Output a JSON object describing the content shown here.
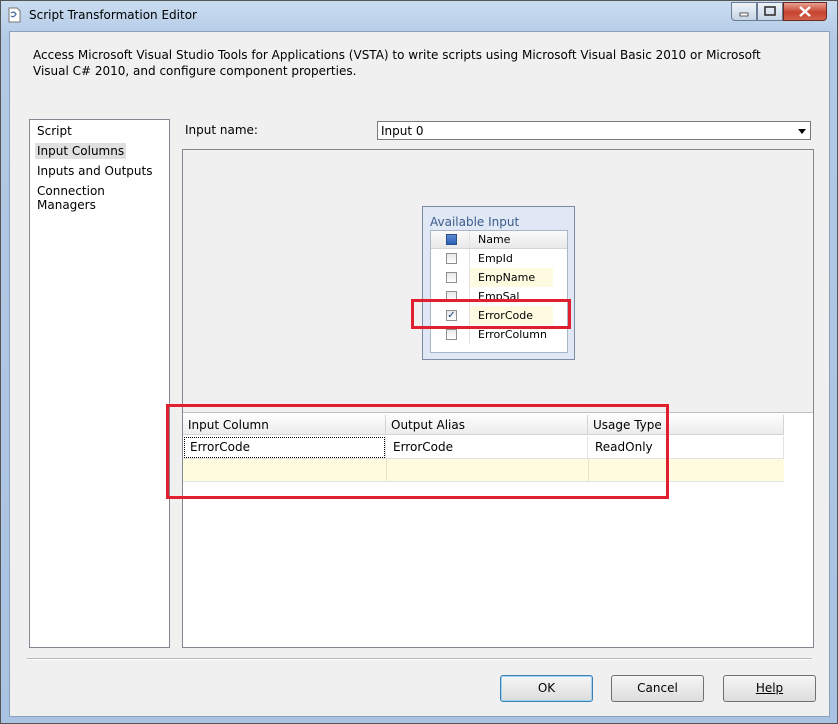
{
  "window": {
    "title": "Script Transformation Editor",
    "icons": [
      "app-icon",
      "minimize-icon",
      "maximize-icon",
      "close-icon"
    ]
  },
  "description": "Access Microsoft Visual Studio Tools for Applications (VSTA) to write scripts using Microsoft Visual Basic 2010 or Microsoft Visual C# 2010, and configure component properties.",
  "nav": {
    "items": [
      {
        "label": "Script"
      },
      {
        "label": "Input Columns",
        "selected": true
      },
      {
        "label": "Inputs and Outputs"
      },
      {
        "label": "Connection Managers"
      }
    ]
  },
  "input_name": {
    "label": "Input name:",
    "value": "Input 0"
  },
  "available_columns": {
    "title": "Available Input Columns",
    "header": "Name",
    "rows": [
      {
        "name": "EmpId",
        "checked": false
      },
      {
        "name": "EmpName",
        "checked": false
      },
      {
        "name": "EmpSal",
        "checked": false
      },
      {
        "name": "ErrorCode",
        "checked": true
      },
      {
        "name": "ErrorColumn",
        "checked": false
      }
    ]
  },
  "column_grid": {
    "headers": [
      "Input Column",
      "Output Alias",
      "Usage Type"
    ],
    "rows": [
      {
        "input_column": "ErrorCode",
        "output_alias": "ErrorCode",
        "usage_type": "ReadOnly"
      }
    ]
  },
  "buttons": {
    "ok": "OK",
    "cancel": "Cancel",
    "help": "Help"
  },
  "colors": {
    "highlight_box": "#e0202e",
    "new_row": "#fffbdf"
  }
}
